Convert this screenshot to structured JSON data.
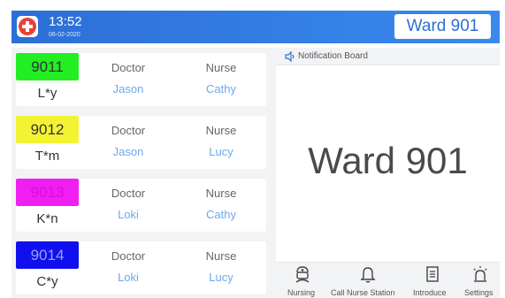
{
  "header": {
    "time": "13:52",
    "date": "06-02-2020",
    "ward_button": "Ward 901",
    "logo_icon": "medical-cross-icon"
  },
  "beds": [
    {
      "number": "9011",
      "color": "#22ee22",
      "patient": "L*y",
      "doctor_label": "Doctor",
      "doctor": "Jason",
      "nurse_label": "Nurse",
      "nurse": "Cathy"
    },
    {
      "number": "9012",
      "color": "#f3f333",
      "patient": "T*m",
      "doctor_label": "Doctor",
      "doctor": "Jason",
      "nurse_label": "Nurse",
      "nurse": "Lucy"
    },
    {
      "number": "9013",
      "color": "#f01ef0",
      "patient": "K*n",
      "doctor_label": "Doctor",
      "doctor": "Loki",
      "nurse_label": "Nurse",
      "nurse": "Cathy"
    },
    {
      "number": "9014",
      "color": "#1010ee",
      "patient": "C*y",
      "doctor_label": "Doctor",
      "doctor": "Loki",
      "nurse_label": "Nurse",
      "nurse": "Lucy"
    }
  ],
  "notification": {
    "label": "Notification Board",
    "icon": "speaker-icon",
    "content": "Ward 901"
  },
  "nav": [
    {
      "label": "Nursing",
      "icon": "nurse-icon"
    },
    {
      "label": "Call Nurse Station",
      "icon": "bell-icon"
    },
    {
      "label": "Introduce",
      "icon": "document-icon"
    },
    {
      "label": "Settings",
      "icon": "alarm-light-icon"
    }
  ]
}
